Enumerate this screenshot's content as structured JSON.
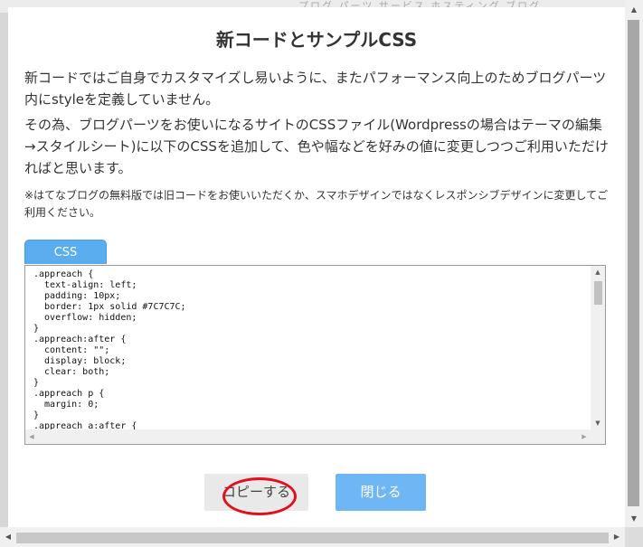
{
  "background": {
    "strip_text": "プログ パーツ サービス ホスティング ブログ"
  },
  "dialog": {
    "title": "新コードとサンプルCSS",
    "paragraph1": "新コードではご自身でカスタマイズし易いように、またパフォーマンス向上のためブログパーツ内にstyleを定義していません。",
    "paragraph2": "その為、ブログパーツをお使いになるサイトのCSSファイル(Wordpressの場合はテーマの編集→スタイルシート)に以下のCSSを追加して、色や幅などを好みの値に変更しつつご利用いただければと思います。",
    "note": "※はてなブログの無料版では旧コードをお使いいただくか、スマホデザインではなくレスポンシブデザインに変更してご利用ください。",
    "tab_label": "CSS",
    "code": ".appreach {\n  text-align: left;\n  padding: 10px;\n  border: 1px solid #7C7C7C;\n  overflow: hidden;\n}\n.appreach:after {\n  content: \"\";\n  display: block;\n  clear: both;\n}\n.appreach p {\n  margin: 0;\n}\n.appreach a:after {",
    "copy_button": "コピーする",
    "close_button": "閉じる"
  },
  "colors": {
    "tab": "#5aaeef",
    "close_button": "#6fb6f4",
    "highlight": "#e0101c"
  },
  "icons": {
    "scroll_up": "triangle-up-icon",
    "scroll_down": "triangle-down-icon",
    "scroll_left": "triangle-left-icon",
    "scroll_right": "triangle-right-icon"
  }
}
